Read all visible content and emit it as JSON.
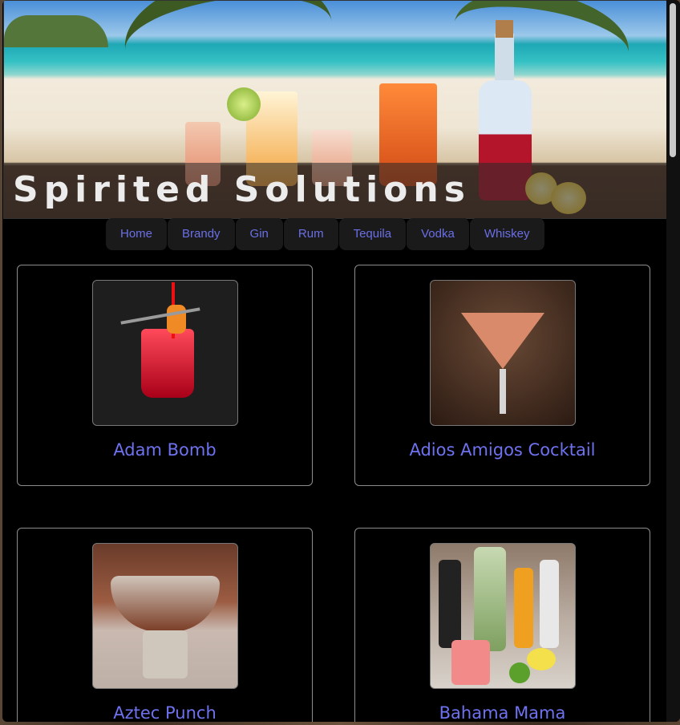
{
  "site": {
    "title": "Spirited Solutions"
  },
  "nav": {
    "items": [
      "Home",
      "Brandy",
      "Gin",
      "Rum",
      "Tequila",
      "Vodka",
      "Whiskey"
    ]
  },
  "cocktails": [
    {
      "name": "Adam Bomb"
    },
    {
      "name": "Adios Amigos Cocktail"
    },
    {
      "name": "Aztec Punch"
    },
    {
      "name": "Bahama Mama"
    }
  ],
  "colors": {
    "link": "#6b6fe6",
    "background": "#000000",
    "nav_bg": "#1a1a1a"
  }
}
